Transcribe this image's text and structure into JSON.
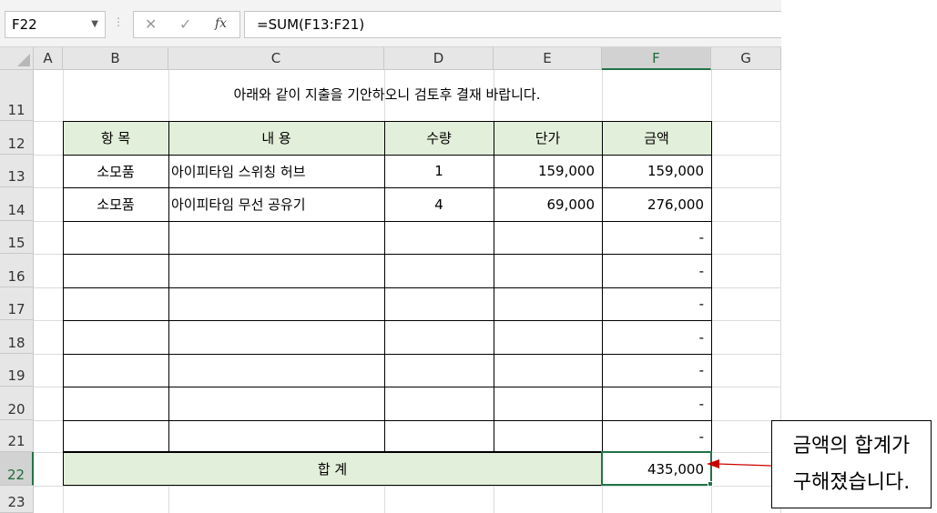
{
  "formula_bar": {
    "name_box": "F22",
    "cancel_icon": "✕",
    "enter_icon": "✓",
    "fx_label": "fx",
    "formula": "=SUM(F13:F21)"
  },
  "columns": [
    "A",
    "B",
    "C",
    "D",
    "E",
    "F",
    "G"
  ],
  "selected_column": "F",
  "rows": [
    "11",
    "12",
    "13",
    "14",
    "15",
    "16",
    "17",
    "18",
    "19",
    "20",
    "21",
    "22",
    "23"
  ],
  "selected_row": "22",
  "sheet": {
    "title": "아래와 같이 지출을 기안하오니 검토후 결재 바랍니다.",
    "headers": [
      "항 목",
      "내 용",
      "수량",
      "단가",
      "금액"
    ],
    "items": [
      {
        "category": "소모품",
        "description": "아이피타임 스위칭 허브",
        "qty": "1",
        "unit_price": "159,000",
        "amount": "159,000"
      },
      {
        "category": "소모품",
        "description": "아이피타임 무선 공유기",
        "qty": "4",
        "unit_price": "69,000",
        "amount": "276,000"
      },
      {
        "category": "",
        "description": "",
        "qty": "",
        "unit_price": "",
        "amount": "-"
      },
      {
        "category": "",
        "description": "",
        "qty": "",
        "unit_price": "",
        "amount": "-"
      },
      {
        "category": "",
        "description": "",
        "qty": "",
        "unit_price": "",
        "amount": "-"
      },
      {
        "category": "",
        "description": "",
        "qty": "",
        "unit_price": "",
        "amount": "-"
      },
      {
        "category": "",
        "description": "",
        "qty": "",
        "unit_price": "",
        "amount": "-"
      },
      {
        "category": "",
        "description": "",
        "qty": "",
        "unit_price": "",
        "amount": "-"
      },
      {
        "category": "",
        "description": "",
        "qty": "",
        "unit_price": "",
        "amount": "-"
      }
    ],
    "total_label": "합 계",
    "total_value": "435,000"
  },
  "callout": {
    "line1": "금액의 합계가",
    "line2": "구해졌습니다."
  },
  "colors": {
    "header_fill": "#e2efda",
    "selection": "#217346",
    "arrow": "#cc0000"
  }
}
